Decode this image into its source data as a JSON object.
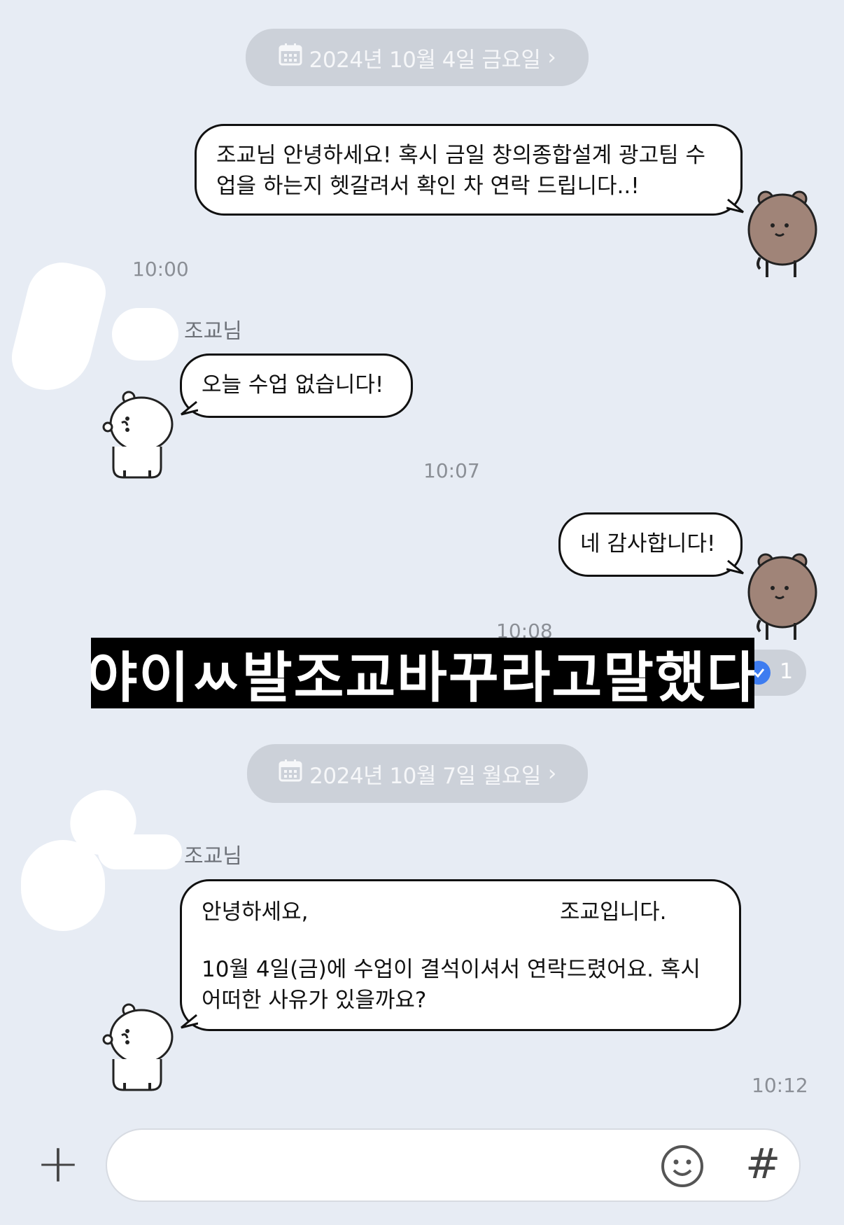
{
  "dates": [
    {
      "label": "2024년 10월 4일 금요일",
      "chevron": "›",
      "icon": "calendar-icon"
    },
    {
      "label": "2024년 10월 7일 월요일",
      "chevron": "›",
      "icon": "calendar-icon"
    }
  ],
  "messages": [
    {
      "text": "조교님 안녕하세요! 혹시 금일 창의종합설계 광고팀 수\n업을 하는지 헷갈려서 확인 차 연락 드립니다..!",
      "time": "10:00"
    },
    {
      "sender": "조교님",
      "text": "오늘 수업 없습니다!",
      "time": "10:07"
    },
    {
      "text": "네 감사합니다!",
      "time": "10:08"
    },
    {
      "sender": "조교님",
      "greeting": "안녕하세요,",
      "greeting_tail": "조교입니다.",
      "text": "10월 4일(금)에 수업이 결석이셔서 연락드렸어요. 혹시\n어떠한 사유가 있을까요?",
      "time": "10:12"
    }
  ],
  "overlay_caption": "야이ㅆ발조교바꾸라고말했다",
  "read_badge": "1",
  "input": {
    "plus": "+",
    "hash": "#"
  },
  "colors": {
    "background": "#e7ecf4",
    "caption_bg": "#000000",
    "badge_blue": "#3d7cf0",
    "bear_brown": "#a08478"
  }
}
